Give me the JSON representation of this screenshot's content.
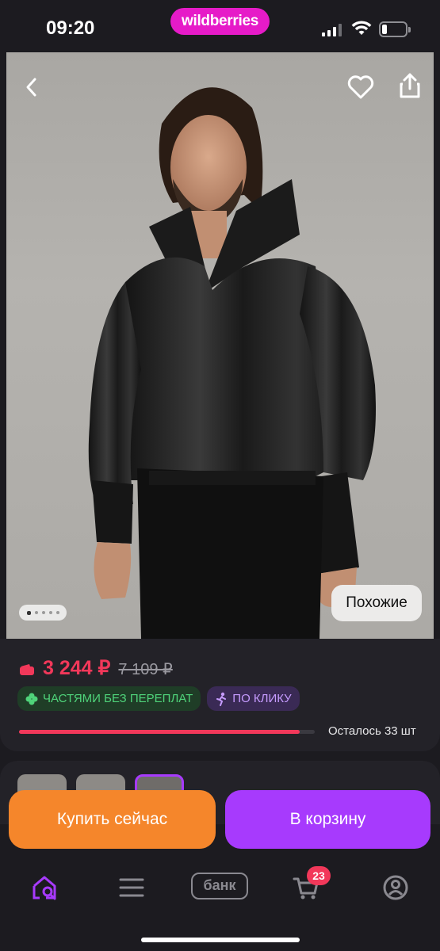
{
  "status_bar": {
    "time": "09:20",
    "brand": "wildberries",
    "battery_level": 0.2
  },
  "photo": {
    "similar_label": "Похожие",
    "gallery_total": 5,
    "gallery_active": 1
  },
  "product": {
    "price": "3 244 ₽",
    "old_price": "7 109 ₽",
    "chips": {
      "installments": "ЧАСТЯМИ БЕЗ ПЕРЕПЛАТ",
      "one_click": "ПО КЛИКУ"
    },
    "stock_label": "Осталось 33 шт",
    "stock_fill": 0.95
  },
  "actions": {
    "buy_now": "Купить сейчас",
    "add_to_cart": "В корзину"
  },
  "tabbar": {
    "bank_label": "банк",
    "cart_count": "23",
    "accent": "#a73afd"
  },
  "colors": {
    "brand": "#e61bc8",
    "price": "#f2385a",
    "buy": "#f5862b",
    "cart": "#a73afd"
  }
}
